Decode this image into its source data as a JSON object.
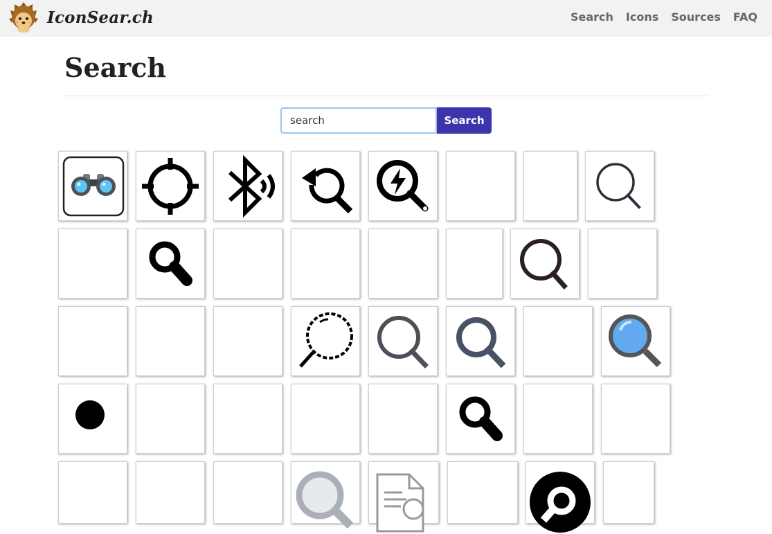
{
  "site": {
    "brand": "IconSear.ch",
    "logo_icon": "hedgehog-icon",
    "nav": [
      "Search",
      "Icons",
      "Sources",
      "FAQ"
    ]
  },
  "page": {
    "title": "Search"
  },
  "search": {
    "value": "search",
    "placeholder": "search",
    "button_label": "Search"
  },
  "colors": {
    "accent": "#3d34ac",
    "navbar": "#f2f2f2",
    "input_border": "#9cc3f0"
  },
  "results": [
    [
      "binoculars-emoji-icon",
      "crosshair-icon",
      "bluetooth-searching-icon",
      "search-refresh-icon",
      "search-lightning-icon",
      "magnifier-thick-icon",
      "magnifier-icon",
      "magnifier-thin-icon"
    ],
    [
      "magnifier-large-outline-icon",
      "magnifier-solid-handle-icon",
      "magnifier-bold-icon",
      "magnifier-medium-icon",
      "magnifier-bold-icon",
      "magnifier-medium-icon",
      "magnifier-dark-gray-icon",
      "magnifier-medium-icon"
    ],
    [
      "magnifier-medium-icon",
      "magnifier-medium-icon",
      "magnifier-bold-icon",
      "magnifier-pixel-art-icon",
      "magnifier-gray-icon",
      "magnifier-slate-icon",
      "magnifier-medium-icon",
      "magnifier-blue-lens-icon"
    ],
    [
      "dot-icon",
      "magnifier-medium-icon",
      "magnifier-medium-icon",
      "magnifier-medium-icon",
      "magnifier-bold-icon",
      "magnifier-solid-handle-icon",
      "magnifier-small-icon",
      "magnifier-small-icon"
    ],
    [
      "magnifier-medium-icon",
      "magnifier-medium-icon",
      "magnifier-bold-icon",
      "magnifier-silver-icon",
      "document-search-icon",
      "magnifier-bold-icon",
      "magnifier-circle-icon",
      "blank-icon"
    ]
  ]
}
